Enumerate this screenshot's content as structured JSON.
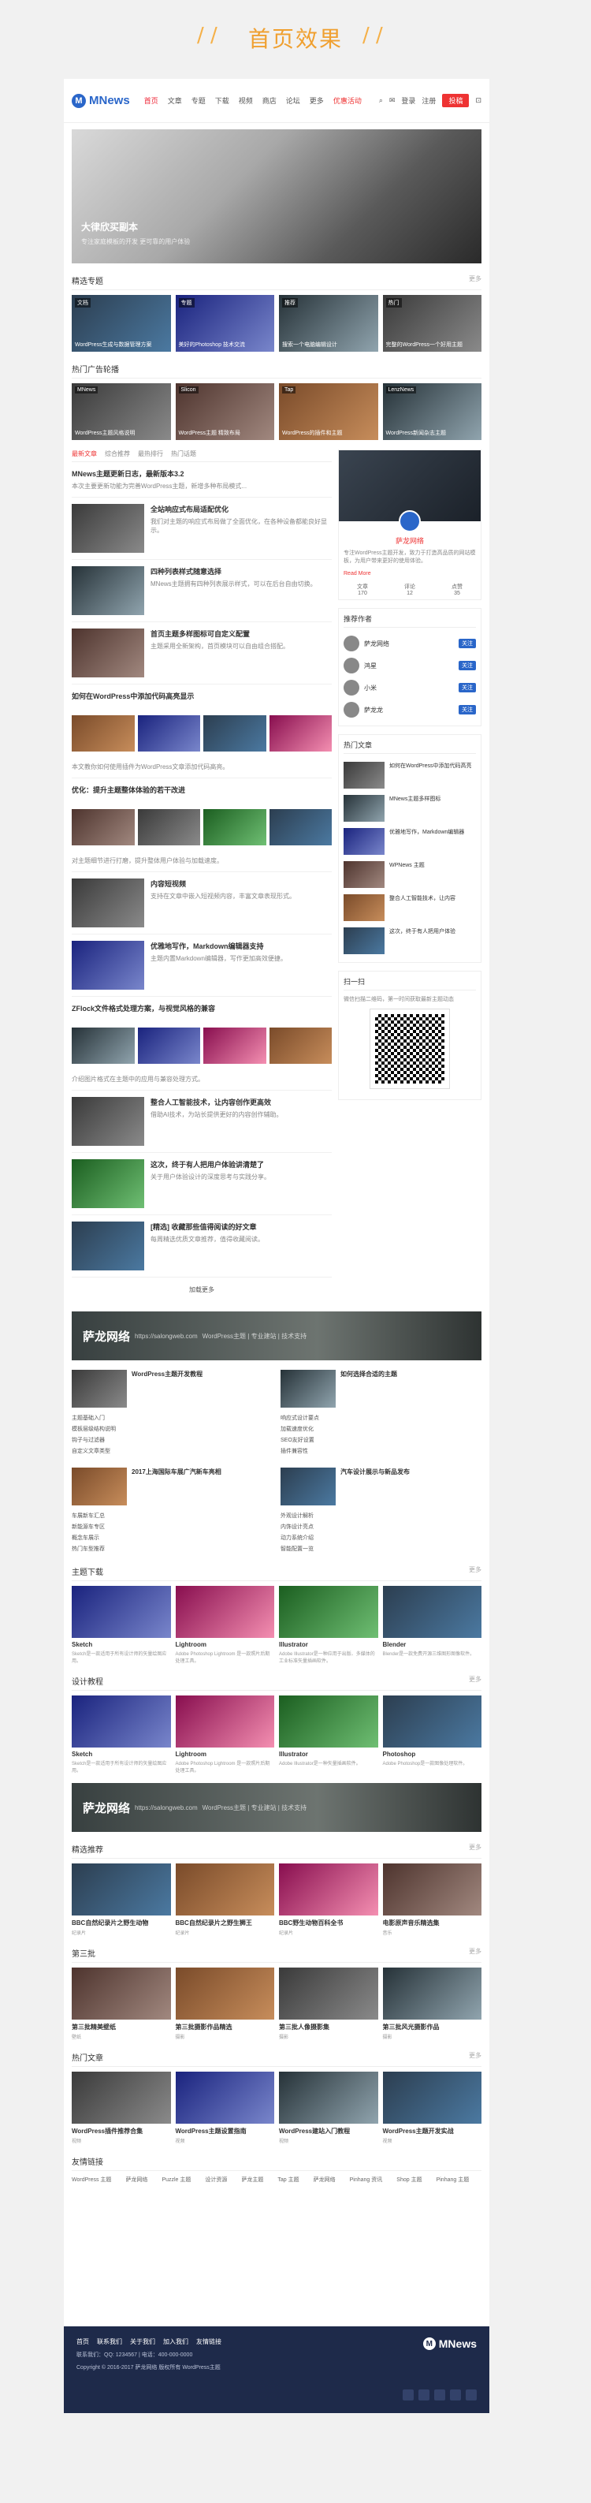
{
  "hero": {
    "title": "首页效果"
  },
  "header": {
    "logo": "MNews",
    "nav": [
      "首页",
      "文章",
      "专题",
      "下载",
      "视频",
      "商店",
      "论坛",
      "更多"
    ],
    "hot_tag": "优惠活动",
    "login": "登录",
    "register": "注册",
    "post_btn": "投稿"
  },
  "banner": {
    "title": "大律欣买副本",
    "subtitle": "专注家庭模板的开发 更可靠的用户体验"
  },
  "sections": {
    "hot_topics": "精选专题",
    "zt": "热门广告轮播",
    "soft": "主题下载",
    "design": "设计教程",
    "featured": "精选推荐",
    "share": "第三批",
    "videos": "热门文章",
    "links": "友情链接",
    "more": "更多"
  },
  "topics": [
    {
      "tag": "文档",
      "text": "WordPress生成与数据管理方案"
    },
    {
      "tag": "专题",
      "text": "美好的Photoshop 技术交流"
    },
    {
      "tag": "推荐",
      "text": "搜索一个电脑编辑设计"
    },
    {
      "tag": "热门",
      "text": "完整的WordPress一个好用主题"
    }
  ],
  "ads": [
    {
      "tag": "MNews",
      "text": "WordPress主题风格说明"
    },
    {
      "tag": "Slicon",
      "text": "WordPress主题 精致布局"
    },
    {
      "tag": "Tap",
      "text": "WordPress的插件和主题"
    },
    {
      "tag": "LenzNews",
      "text": "WordPress新闻杂志主题"
    }
  ],
  "tabs": [
    "最新文章",
    "综合推荐",
    "最热排行",
    "热门话题"
  ],
  "posts": [
    {
      "title": "MNews主题更新日志，最新版本3.2",
      "excerpt": "本次主要更新功能为完善WordPress主题，新增多种布局模式..."
    },
    {
      "title": "全站响应式布局适配优化",
      "excerpt": "我们对主题的响应式布局做了全面优化，在各种设备都能良好显示。"
    },
    {
      "title": "四种列表样式随意选择",
      "excerpt": "MNews主题拥有四种列表展示样式，可以在后台自由切换。"
    },
    {
      "title": "首页主题多样图标可自定义配置",
      "excerpt": "主题采用全新架构，首页模块可以自由组合搭配。"
    },
    {
      "title": "如何在WordPress中添加代码高亮显示",
      "excerpt": "本文教你如何使用插件为WordPress文章添加代码高亮。"
    },
    {
      "title": "优化：提升主题整体体验的若干改进",
      "excerpt": "对主题细节进行打磨，提升整体用户体验与加载速度。"
    },
    {
      "title": "内容短视频",
      "excerpt": "支持在文章中嵌入短视频内容，丰富文章表现形式。"
    },
    {
      "title": "优雅地写作，Markdown编辑器支持",
      "excerpt": "主题内置Markdown编辑器，写作更加高效便捷。"
    },
    {
      "title": "ZFlock文件格式处理方案，与视觉风格的兼容",
      "excerpt": "介绍图片格式在主题中的应用与兼容处理方式。"
    },
    {
      "title": "整合人工智能技术，让内容创作更高效",
      "excerpt": "借助AI技术，为站长提供更好的内容创作辅助。"
    },
    {
      "title": "这次，终于有人把用户体验讲清楚了",
      "excerpt": "关于用户体验设计的深度思考与实践分享。"
    },
    {
      "title": "[精选] 收藏那些值得阅读的好文章",
      "excerpt": "每周精选优质文章推荐，值得收藏阅读。"
    }
  ],
  "loadmore": "加载更多",
  "author": {
    "name": "萨龙网络",
    "desc": "专注WordPress主题开发，致力于打造高品质的网站模板，为用户带来更好的使用体验。",
    "more": "Read More",
    "stats": [
      {
        "label": "文章",
        "value": "170"
      },
      {
        "label": "评论",
        "value": "12"
      },
      {
        "label": "点赞",
        "value": "35"
      }
    ]
  },
  "authors_title": "推荐作者",
  "authors": [
    {
      "name": "萨龙网络",
      "btn": "关注"
    },
    {
      "name": "鸿星",
      "btn": "关注"
    },
    {
      "name": "小米",
      "btn": "关注"
    },
    {
      "name": "萨龙龙",
      "btn": "关注"
    }
  ],
  "hot_title": "热门文章",
  "hot": [
    "如何在WordPress中添加代码高亮",
    "MNews主题多样图标",
    "优雅地写作，Markdown编辑器",
    "WPNews 主题",
    "整合人工智能技术，让内容",
    "这次，终于有人把用户体验"
  ],
  "scan_title": "扫一扫",
  "scan_desc": "微信扫描二维码，第一时间获取最新主题动态",
  "adbar": {
    "brand": "萨龙网络",
    "url": "https://salongweb.com",
    "slogan": "WordPress主题 | 专业建站 | 技术支持"
  },
  "boxes": [
    {
      "title": "WordPress主题开发教程",
      "items": [
        "主题基础入门",
        "模板层级结构说明",
        "钩子与过滤器",
        "自定义文章类型"
      ]
    },
    {
      "title": "如何选择合适的主题",
      "items": [
        "响应式设计要点",
        "加载速度优化",
        "SEO友好设置",
        "插件兼容性"
      ]
    }
  ],
  "boxes2": [
    {
      "title": "2017上海国际车展广汽新车亮相",
      "items": [
        "车展新车汇总",
        "新能源车专区",
        "概念车展示",
        "热门车型推荐"
      ]
    },
    {
      "title": "汽车设计展示与新品发布",
      "items": [
        "外观设计解析",
        "内饰设计亮点",
        "动力系统介绍",
        "智能配置一览"
      ]
    }
  ],
  "soft": [
    {
      "name": "Sketch",
      "desc": "Sketch是一款适用于所有设计师的矢量绘图应用。"
    },
    {
      "name": "Lightroom",
      "desc": "Adobe Photoshop Lightroom 是一款照片后期处理工具。"
    },
    {
      "name": "Illustrator",
      "desc": "Adobe Illustrator是一种应用于出版、多媒体的工业标准矢量插画软件。"
    },
    {
      "name": "Blender",
      "desc": "Blender是一款免费开源三维图形图像软件。"
    }
  ],
  "design": [
    {
      "name": "Sketch",
      "desc": "Sketch是一款适用于所有设计师的矢量绘图应用。"
    },
    {
      "name": "Lightroom",
      "desc": "Adobe Photoshop Lightroom 是一款照片后期处理工具。"
    },
    {
      "name": "Illustrator",
      "desc": "Adobe Illustrator是一种矢量插画软件。"
    },
    {
      "name": "Photoshop",
      "desc": "Adobe Photoshop是一款图像处理软件。"
    }
  ],
  "featured": [
    {
      "name": "BBC自然纪录片之野生动物",
      "desc": "纪录片"
    },
    {
      "name": "BBC自然纪录片之野生狮王",
      "desc": "纪录片"
    },
    {
      "name": "BBC野生动物百科全书",
      "desc": "纪录片"
    },
    {
      "name": "电影原声音乐精选集",
      "desc": "音乐"
    }
  ],
  "share": [
    {
      "name": "第三批精美壁纸",
      "desc": "壁纸"
    },
    {
      "name": "第三批摄影作品精选",
      "desc": "摄影"
    },
    {
      "name": "第三批人像摄影集",
      "desc": "摄影"
    },
    {
      "name": "第三批风光摄影作品",
      "desc": "摄影"
    }
  ],
  "videos": [
    {
      "name": "WordPress插件推荐合集",
      "desc": "视频"
    },
    {
      "name": "WordPress主题设置指南",
      "desc": "视频"
    },
    {
      "name": "WordPress建站入门教程",
      "desc": "视频"
    },
    {
      "name": "WordPress主题开发实战",
      "desc": "视频"
    }
  ],
  "links": [
    "WordPress 主题",
    "萨龙网络",
    "Puzzle 主题",
    "设计资源",
    "萨龙主题",
    "Tap 主题",
    "萨龙网络",
    "Pinhang 资讯",
    "Shop 主题",
    "Pinhang 主题"
  ],
  "footer": {
    "links": [
      "首页",
      "联系我们",
      "关于我们",
      "加入我们",
      "友情链接"
    ],
    "line1": "联系我们：QQ: 1234567 | 电话：400-000-0000",
    "line2": "Copyright © 2016-2017 萨龙网络 版权所有 WordPress主题",
    "logo": "MNews"
  }
}
